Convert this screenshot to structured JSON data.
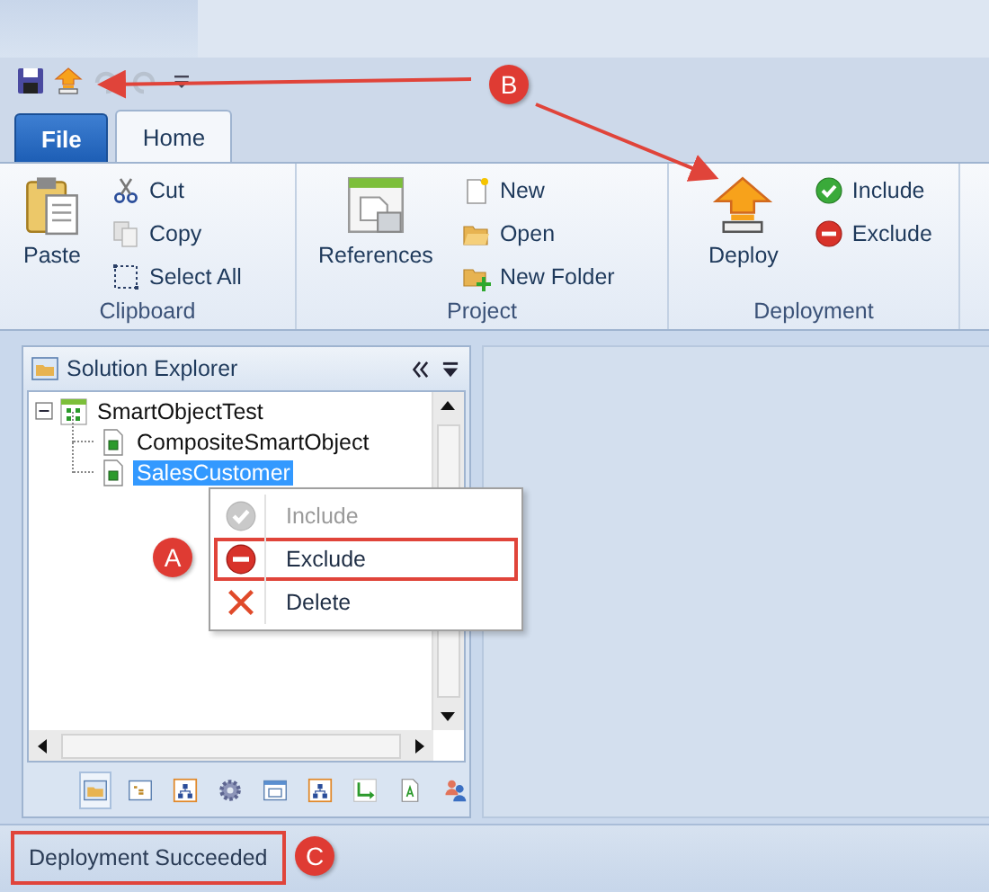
{
  "tabs": [
    {
      "label": "File",
      "kind": "file",
      "selected": false
    },
    {
      "label": "Home",
      "kind": "tab",
      "selected": true
    }
  ],
  "ribbon": {
    "groups": [
      {
        "title": "Clipboard",
        "large": {
          "label": "Paste"
        },
        "small": [
          {
            "label": "Cut"
          },
          {
            "label": "Copy"
          },
          {
            "label": "Select All"
          }
        ]
      },
      {
        "title": "Project",
        "large": {
          "label": "References"
        },
        "small": [
          {
            "label": "New"
          },
          {
            "label": "Open"
          },
          {
            "label": "New Folder"
          }
        ]
      },
      {
        "title": "Deployment",
        "large": {
          "label": "Deploy"
        },
        "small": [
          {
            "label": "Include"
          },
          {
            "label": "Exclude"
          }
        ]
      }
    ]
  },
  "explorer": {
    "title": "Solution Explorer",
    "tree": [
      {
        "label": "SmartObjectTest",
        "expanded": true,
        "selected": false,
        "children": [
          {
            "label": "CompositeSmartObject",
            "selected": false
          },
          {
            "label": "SalesCustomer",
            "selected": true
          }
        ]
      }
    ]
  },
  "context_menu": [
    {
      "label": "Include",
      "disabled": true,
      "highlighted": false
    },
    {
      "label": "Exclude",
      "disabled": false,
      "highlighted": true
    },
    {
      "label": "Delete",
      "disabled": false,
      "highlighted": false
    }
  ],
  "status_bar": {
    "text": "Deployment Succeeded",
    "highlighted": true
  },
  "callouts": [
    {
      "label": "A"
    },
    {
      "label": "B"
    },
    {
      "label": "C"
    }
  ]
}
